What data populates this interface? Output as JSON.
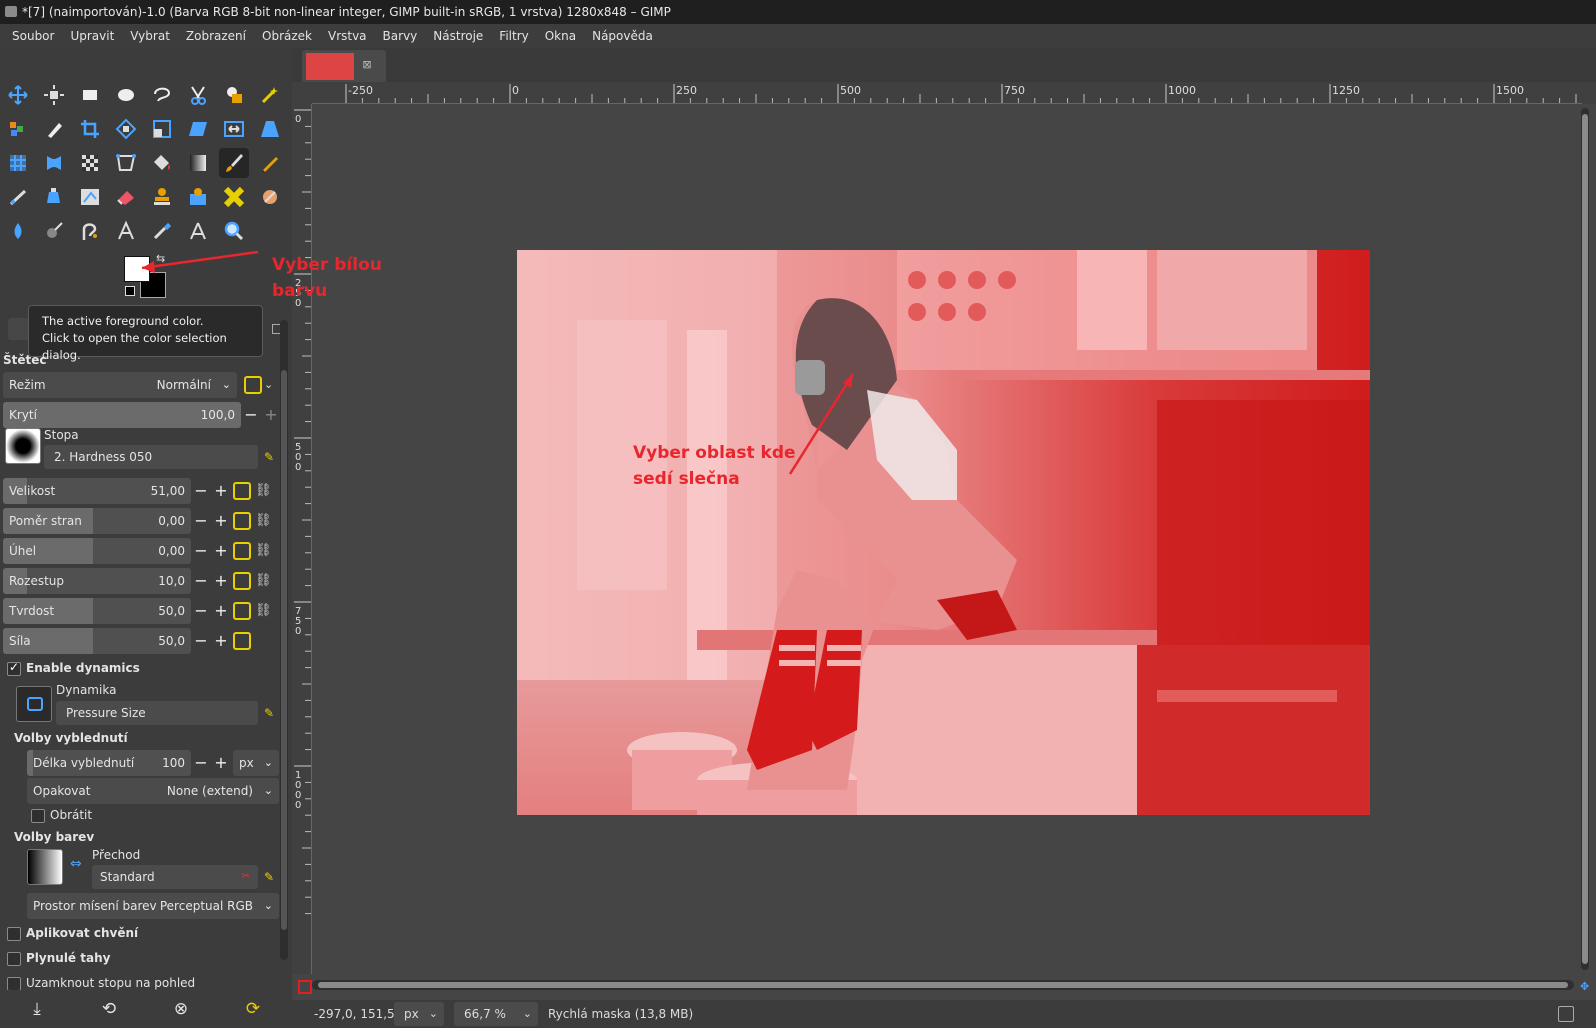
{
  "title": "*[7] (naimportován)-1.0 (Barva RGB 8-bit non-linear integer, GIMP built-in sRGB, 1 vrstva) 1280x848 – GIMP",
  "menu": [
    "Soubor",
    "Upravit",
    "Vybrat",
    "Zobrazení",
    "Obrázek",
    "Vrstva",
    "Barvy",
    "Nástroje",
    "Filtry",
    "Okna",
    "Nápověda"
  ],
  "tooltip": {
    "line1": "The active foreground color.",
    "line2": "Click to open the color selection dialog."
  },
  "annotations": {
    "white_color_line1": "Vyber bílou",
    "white_color_line2": "barvu",
    "area_line1": "Vyber oblast kde",
    "area_line2": "sedí slečna",
    "color": "#e8262e"
  },
  "tool_options": {
    "section_title": "Štětec",
    "mode": {
      "label": "Režim",
      "value": "Normální"
    },
    "opacity": {
      "label": "Krytí",
      "value": "100,0",
      "fraction": 1.0
    },
    "brush": {
      "label": "Stopa",
      "value": "2. Hardness 050"
    },
    "size": {
      "label": "Velikost",
      "value": "51,00",
      "fraction": 0.1
    },
    "aspect": {
      "label": "Poměr stran",
      "value": "0,00",
      "fraction": 0.5
    },
    "angle": {
      "label": "Úhel",
      "value": "0,00",
      "fraction": 0.5
    },
    "spacing": {
      "label": "Rozestup",
      "value": "10,0",
      "fraction": 0.1
    },
    "hardness": {
      "label": "Tvrdost",
      "value": "50,0",
      "fraction": 0.5
    },
    "force": {
      "label": "Síla",
      "value": "50,0",
      "fraction": 0.5
    },
    "enable_dynamics": {
      "label": "Enable dynamics",
      "checked": true
    },
    "dynamics": {
      "label": "Dynamika",
      "value": "Pressure Size"
    },
    "fade_section": "Volby vyblednutí",
    "fade_length": {
      "label": "Délka vyblednutí",
      "value": "100",
      "unit": "px"
    },
    "repeat": {
      "label": "Opakovat",
      "value": "None (extend)"
    },
    "reverse": {
      "label": "Obrátit",
      "checked": false
    },
    "color_section": "Volby barev",
    "gradient": {
      "label": "Přechod",
      "value": "Standard"
    },
    "blend_space": {
      "label": "Prostor mísení barev",
      "value": "Perceptual RGB"
    },
    "jitter": {
      "label": "Aplikovat chvění",
      "checked": false
    },
    "smooth": {
      "label": "Plynulé tahy",
      "checked": false
    },
    "lock_brush": {
      "label": "Uzamknout stopu na pohled",
      "checked": false
    }
  },
  "ruler": {
    "h_labels": [
      "-250",
      "0",
      "250",
      "500",
      "750",
      "1000",
      "1250",
      "1500"
    ],
    "v_labels": [
      "0",
      "250",
      "500",
      "750",
      "1000"
    ]
  },
  "status": {
    "coords": "-297,0, 151,5",
    "unit": "px",
    "zoom": "66,7 %",
    "message": "Rychlá maska (13,8 MB)"
  },
  "colors": {
    "foreground": "#ffffff",
    "background": "#000000",
    "quick_mask": "#e02020"
  }
}
